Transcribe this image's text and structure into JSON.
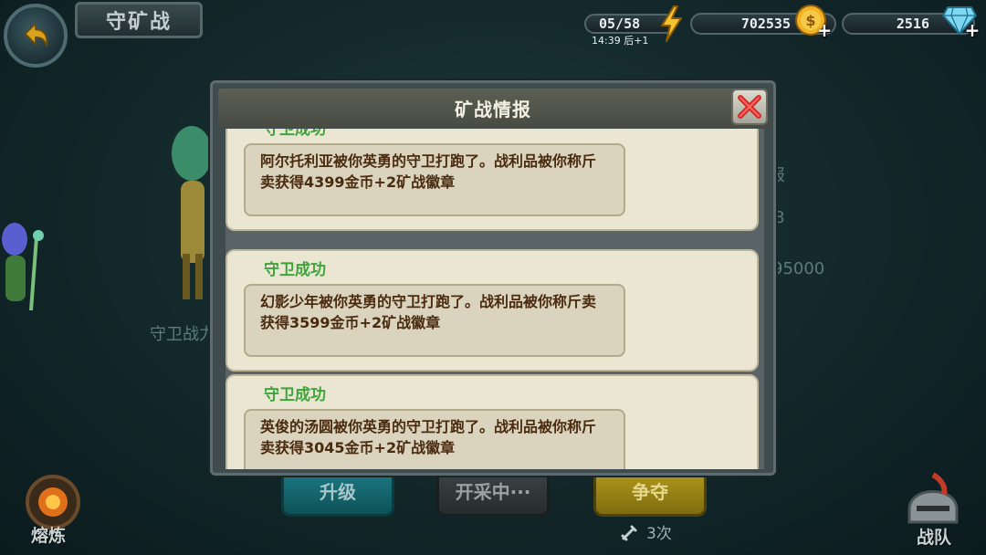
{
  "header": {
    "title": "守矿战",
    "energy": "05/58",
    "energy_timer": "14:39 后+1",
    "gold": "702535",
    "gems": "2516"
  },
  "background": {
    "guard_power_label": "守卫战力",
    "side_text_1": "报",
    "side_text_2": "8",
    "side_text_3": "95000",
    "buttons": {
      "upgrade": "升级",
      "mining": "开采中···",
      "contest": "争夺"
    },
    "attempts": "3次",
    "smelt_label": "熔炼",
    "team_label": "战队"
  },
  "modal": {
    "title": "矿战情报",
    "reports": [
      {
        "title": "守卫成功",
        "text": "阿尔托利亚被你英勇的守卫打跑了。战利品被你称斤卖获得4399金币+2矿战徽章"
      },
      {
        "title": "守卫成功",
        "text": "幻影少年被你英勇的守卫打跑了。战利品被你称斤卖获得3599金币+2矿战徽章"
      },
      {
        "title": "守卫成功",
        "text": "英俊的汤圆被你英勇的守卫打跑了。战利品被你称斤卖获得3045金币+2矿战徽章"
      }
    ]
  },
  "colors": {
    "success_green": "#3fa33c",
    "report_text": "#4a2b10",
    "close_red": "#d42a2a"
  }
}
